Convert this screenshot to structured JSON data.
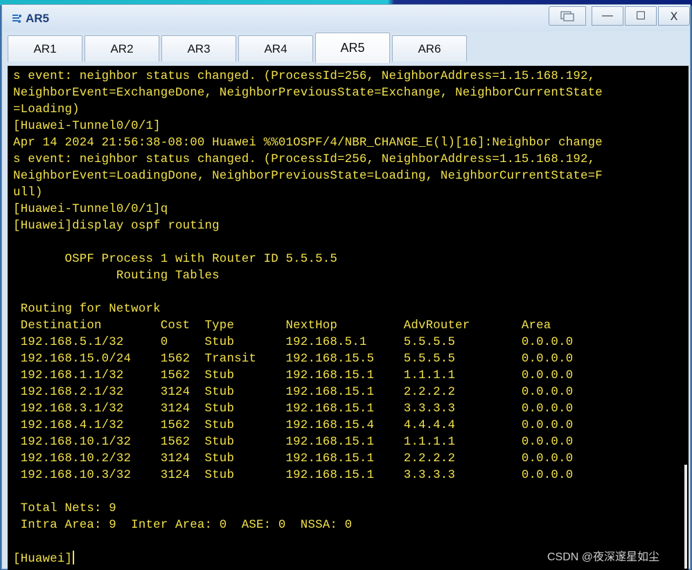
{
  "window": {
    "title": "AR5",
    "controls": {
      "restore_icon": "restore-icon",
      "minimize": "—",
      "maximize": "☐",
      "close": "X"
    }
  },
  "tabs": [
    {
      "label": "AR1",
      "active": false
    },
    {
      "label": "AR2",
      "active": false
    },
    {
      "label": "AR3",
      "active": false
    },
    {
      "label": "AR4",
      "active": false
    },
    {
      "label": "AR5",
      "active": true
    },
    {
      "label": "AR6",
      "active": false
    }
  ],
  "terminal": {
    "lines": [
      "s event: neighbor status changed. (ProcessId=256, NeighborAddress=1.15.168.192,",
      "NeighborEvent=ExchangeDone, NeighborPreviousState=Exchange, NeighborCurrentState",
      "=Loading)",
      "[Huawei-Tunnel0/0/1]",
      "Apr 14 2024 21:56:38-08:00 Huawei %%01OSPF/4/NBR_CHANGE_E(l)[16]:Neighbor change",
      "s event: neighbor status changed. (ProcessId=256, NeighborAddress=1.15.168.192,",
      "NeighborEvent=LoadingDone, NeighborPreviousState=Loading, NeighborCurrentState=F",
      "ull)",
      "[Huawei-Tunnel0/0/1]q",
      "[Huawei]display ospf routing",
      "",
      "       OSPF Process 1 with Router ID 5.5.5.5",
      "              Routing Tables",
      "",
      " Routing for Network",
      " Destination        Cost  Type       NextHop         AdvRouter       Area",
      " 192.168.5.1/32     0     Stub       192.168.5.1     5.5.5.5         0.0.0.0",
      " 192.168.15.0/24    1562  Transit    192.168.15.5    5.5.5.5         0.0.0.0",
      " 192.168.1.1/32     1562  Stub       192.168.15.1    1.1.1.1         0.0.0.0",
      " 192.168.2.1/32     3124  Stub       192.168.15.1    2.2.2.2         0.0.0.0",
      " 192.168.3.1/32     3124  Stub       192.168.15.1    3.3.3.3         0.0.0.0",
      " 192.168.4.1/32     1562  Stub       192.168.15.4    4.4.4.4         0.0.0.0",
      " 192.168.10.1/32    1562  Stub       192.168.15.1    1.1.1.1         0.0.0.0",
      " 192.168.10.2/32    3124  Stub       192.168.15.1    2.2.2.2         0.0.0.0",
      " 192.168.10.3/32    3124  Stub       192.168.15.1    3.3.3.3         0.0.0.0",
      "",
      " Total Nets: 9",
      " Intra Area: 9  Inter Area: 0  ASE: 0  NSSA: 0",
      "",
      "[Huawei]"
    ]
  },
  "watermark": "CSDN @夜深邃星如尘"
}
